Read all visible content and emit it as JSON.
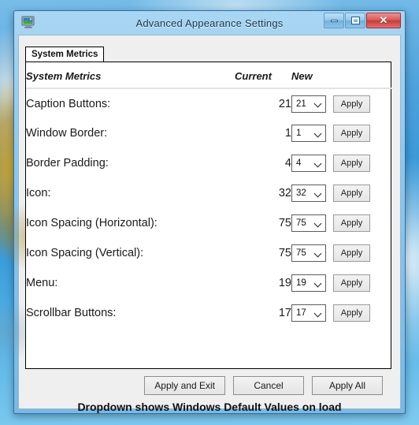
{
  "window": {
    "title": "Advanced Appearance Settings",
    "icon": "display-monitor-icon",
    "controls": {
      "minimize_label": "",
      "maximize_label": "",
      "close_label": "✕"
    }
  },
  "tabs": [
    {
      "label": "System Metrics",
      "selected": true
    }
  ],
  "table": {
    "headers": {
      "label": "System Metrics",
      "current": "Current",
      "new": "New"
    },
    "apply_label": "Apply",
    "rows": [
      {
        "label": "Caption Buttons:",
        "current": "21",
        "new": "21"
      },
      {
        "label": "Window Border:",
        "current": "1",
        "new": "1"
      },
      {
        "label": "Border Padding:",
        "current": "4",
        "new": "4"
      },
      {
        "label": "Icon:",
        "current": "32",
        "new": "32"
      },
      {
        "label": "Icon Spacing (Horizontal):",
        "current": "75",
        "new": "75"
      },
      {
        "label": "Icon Spacing (Vertical):",
        "current": "75",
        "new": "75"
      },
      {
        "label": "Menu:",
        "current": "19",
        "new": "19"
      },
      {
        "label": "Scrollbar Buttons:",
        "current": "17",
        "new": "17"
      }
    ]
  },
  "footer": {
    "apply_and_exit": "Apply and Exit",
    "cancel": "Cancel",
    "apply_all": "Apply All",
    "note": "Dropdown shows Windows Default Values on load"
  },
  "colors": {
    "titlebar_blue": "#8cc6ec",
    "close_red": "#dc5b5b",
    "dialog_bg": "#efefef",
    "panel_bg": "#ffffff",
    "border_black": "#000000"
  }
}
